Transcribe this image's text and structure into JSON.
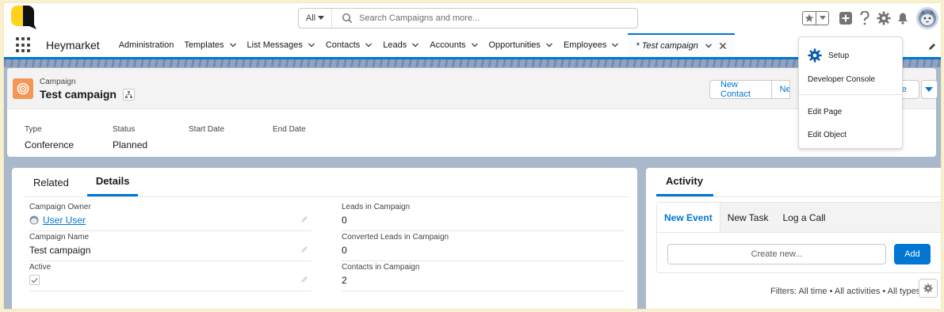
{
  "header": {
    "search_scope": "All",
    "search_placeholder": "Search Campaigns and more..."
  },
  "nav": {
    "app_name": "Heymarket",
    "items": [
      {
        "label": "Administration",
        "has_menu": false
      },
      {
        "label": "Templates",
        "has_menu": true
      },
      {
        "label": "List Messages",
        "has_menu": true
      },
      {
        "label": "Contacts",
        "has_menu": true
      },
      {
        "label": "Leads",
        "has_menu": true
      },
      {
        "label": "Accounts",
        "has_menu": true
      },
      {
        "label": "Opportunities",
        "has_menu": true
      },
      {
        "label": "Employees",
        "has_menu": true
      }
    ],
    "active_tab": "* Test campaign"
  },
  "record": {
    "object_label": "Campaign",
    "title": "Test campaign",
    "actions": [
      "New Contact",
      "Ne",
      "e"
    ],
    "highlights": [
      {
        "label": "Type",
        "value": "Conference"
      },
      {
        "label": "Status",
        "value": "Planned"
      },
      {
        "label": "Start Date",
        "value": ""
      },
      {
        "label": "End Date",
        "value": ""
      }
    ]
  },
  "details": {
    "tabs": [
      "Related",
      "Details"
    ],
    "left_fields": [
      {
        "label": "Campaign Owner",
        "value": "User User"
      },
      {
        "label": "Campaign Name",
        "value": "Test campaign"
      },
      {
        "label": "Active",
        "value": ""
      }
    ],
    "right_fields": [
      {
        "label": "Leads in Campaign",
        "value": "0"
      },
      {
        "label": "Converted Leads in Campaign",
        "value": "0"
      },
      {
        "label": "Contacts in Campaign",
        "value": "2"
      }
    ]
  },
  "activity": {
    "title": "Activity",
    "tabs": [
      "New Event",
      "New Task",
      "Log a Call"
    ],
    "create_placeholder": "Create new...",
    "add_label": "Add",
    "filters": "Filters: All time • All activities • All types"
  },
  "setup_menu": {
    "items": [
      "Setup",
      "Developer Console",
      "Edit Page",
      "Edit Object"
    ]
  },
  "colors": {
    "brand_blue": "#0176d3",
    "campaign_icon": "#f49756",
    "logo_yellow": "#ffd21f",
    "background_band": "#aab8cb"
  }
}
